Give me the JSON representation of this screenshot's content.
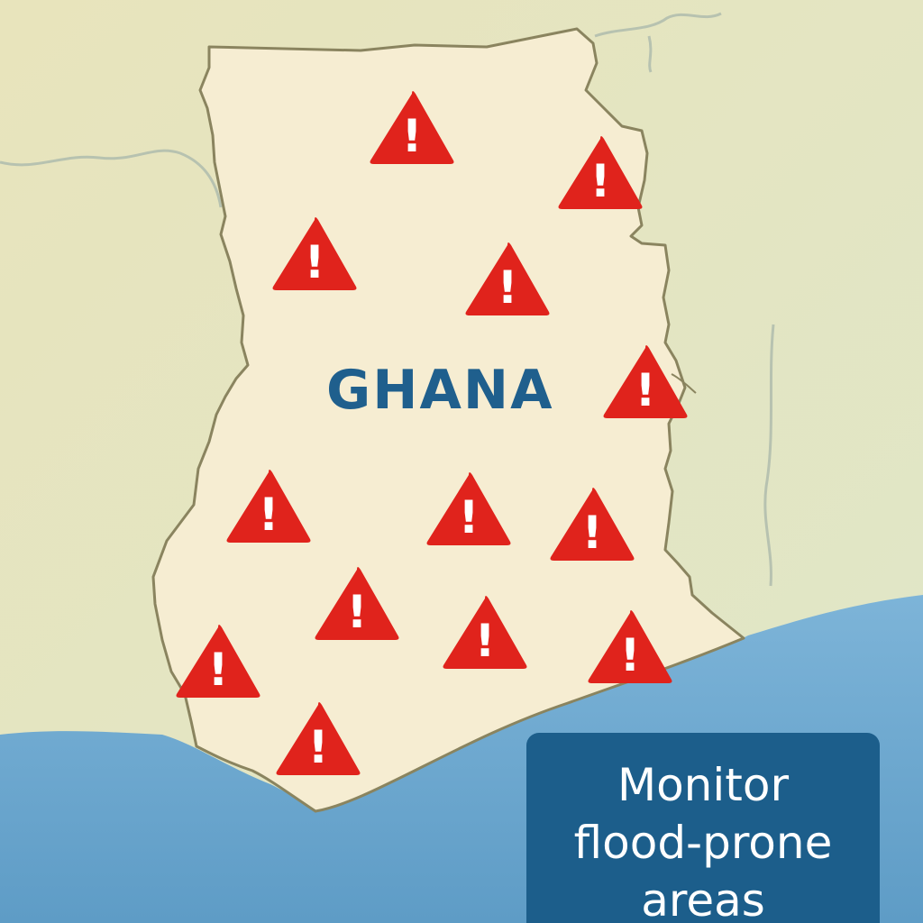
{
  "map": {
    "country_label": "GHANA",
    "callout_text": "Monitor\nflood-prone\nareas",
    "warning_markers": [
      {
        "id": "w1",
        "symbol": "!"
      },
      {
        "id": "w2",
        "symbol": "!"
      },
      {
        "id": "w3",
        "symbol": "!"
      },
      {
        "id": "w4",
        "symbol": "!"
      },
      {
        "id": "w5",
        "symbol": "!"
      },
      {
        "id": "w6",
        "symbol": "!"
      },
      {
        "id": "w7",
        "symbol": "!"
      },
      {
        "id": "w8",
        "symbol": "!"
      },
      {
        "id": "w9",
        "symbol": "!"
      },
      {
        "id": "w10",
        "symbol": "!"
      },
      {
        "id": "w11",
        "symbol": "!"
      },
      {
        "id": "w12",
        "symbol": "!"
      },
      {
        "id": "w13",
        "symbol": "!"
      },
      {
        "id": "w14",
        "symbol": "!"
      }
    ],
    "colors": {
      "land": "#f5ecd0",
      "surrounding_land": "#e9e2b8",
      "ocean": "#6aa8d0",
      "border": "#8a845f",
      "warning_red": "#e0231c",
      "label_blue": "#1f5f8d",
      "callout_bg": "#1c5e8b"
    },
    "icons": [
      "warning-triangle-icon"
    ]
  }
}
